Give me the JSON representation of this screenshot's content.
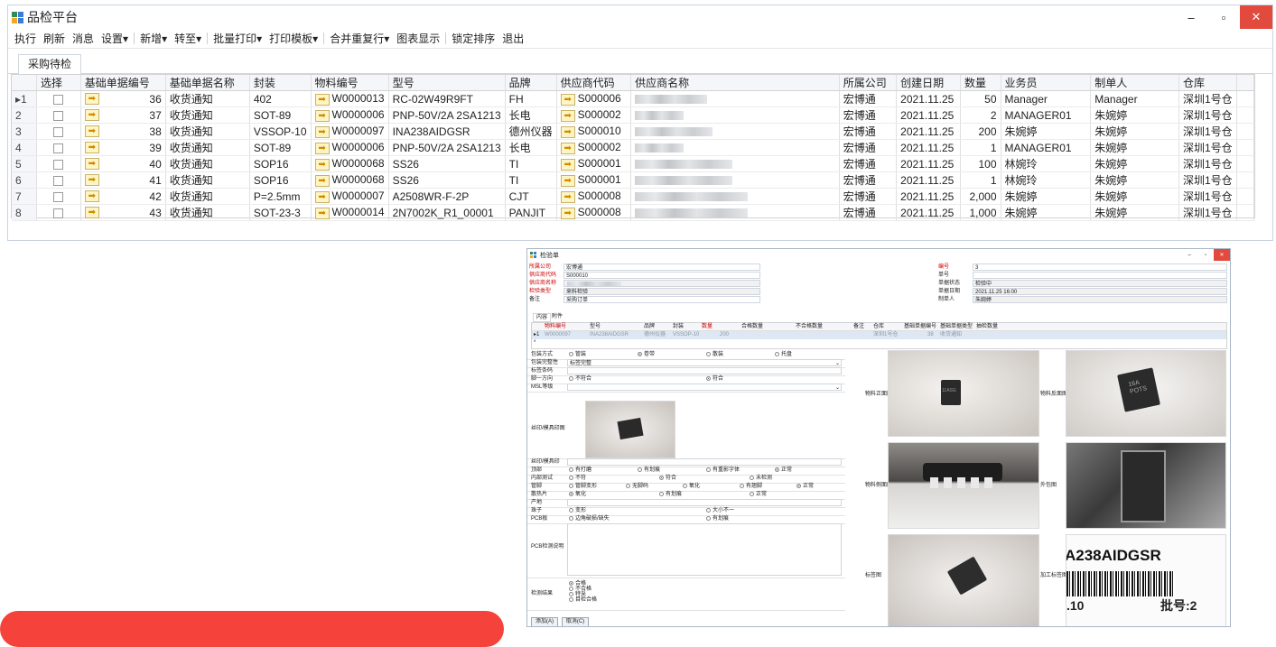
{
  "window": {
    "title": "品检平台",
    "minimize": "–",
    "maximize": "▫",
    "close": "✕"
  },
  "menu": [
    "执行",
    "刷新",
    "消息",
    "设置▾",
    "新增▾",
    "转至▾",
    "批量打印▾",
    "打印模板▾",
    "合并重复行▾",
    "图表显示",
    "锁定排序",
    "退出"
  ],
  "tab": "采购待检",
  "table": {
    "headers": [
      "",
      "选择",
      "基础单据编号",
      "基础单据名称",
      "封装",
      "物料编号",
      "型号",
      "品牌",
      "供应商代码",
      "供应商名称",
      "所属公司",
      "创建日期",
      "数量",
      "业务员",
      "制单人",
      "仓库"
    ],
    "rows": [
      {
        "idx": "▸1",
        "no": "36",
        "name": "收货通知",
        "pkg": "402",
        "mat": "W0000013",
        "model": "RC-02W49R9FT",
        "brand": "FH",
        "sup": "S000006",
        "co": "宏博通",
        "date": "2021.11.25",
        "qty": "50",
        "sales": "Manager",
        "maker": "Manager",
        "wh": "深圳1号仓"
      },
      {
        "idx": "2",
        "no": "37",
        "name": "收货通知",
        "pkg": "SOT-89",
        "mat": "W0000006",
        "model": "PNP-50V/2A 2SA1213",
        "brand": "长电",
        "sup": "S000002",
        "co": "宏博通",
        "date": "2021.11.25",
        "qty": "2",
        "sales": "MANAGER01",
        "maker": "朱婉婷",
        "wh": "深圳1号仓"
      },
      {
        "idx": "3",
        "no": "38",
        "name": "收货通知",
        "pkg": "VSSOP-10",
        "mat": "W0000097",
        "model": "INA238AIDGSR",
        "brand": "德州仪器",
        "sup": "S000010",
        "co": "宏博通",
        "date": "2021.11.25",
        "qty": "200",
        "sales": "朱婉婷",
        "maker": "朱婉婷",
        "wh": "深圳1号仓"
      },
      {
        "idx": "4",
        "no": "39",
        "name": "收货通知",
        "pkg": "SOT-89",
        "mat": "W0000006",
        "model": "PNP-50V/2A 2SA1213",
        "brand": "长电",
        "sup": "S000002",
        "co": "宏博通",
        "date": "2021.11.25",
        "qty": "1",
        "sales": "MANAGER01",
        "maker": "朱婉婷",
        "wh": "深圳1号仓"
      },
      {
        "idx": "5",
        "no": "40",
        "name": "收货通知",
        "pkg": "SOP16",
        "mat": "W0000068",
        "model": "SS26",
        "brand": "TI",
        "sup": "S000001",
        "co": "宏博通",
        "date": "2021.11.25",
        "qty": "100",
        "sales": "林婉玲",
        "maker": "朱婉婷",
        "wh": "深圳1号仓"
      },
      {
        "idx": "6",
        "no": "41",
        "name": "收货通知",
        "pkg": "SOP16",
        "mat": "W0000068",
        "model": "SS26",
        "brand": "TI",
        "sup": "S000001",
        "co": "宏博通",
        "date": "2021.11.25",
        "qty": "1",
        "sales": "林婉玲",
        "maker": "朱婉婷",
        "wh": "深圳1号仓"
      },
      {
        "idx": "7",
        "no": "42",
        "name": "收货通知",
        "pkg": "P=2.5mm",
        "mat": "W0000007",
        "model": "A2508WR-F-2P",
        "brand": "CJT",
        "sup": "S000008",
        "co": "宏博通",
        "date": "2021.11.25",
        "qty": "2,000",
        "sales": "朱婉婷",
        "maker": "朱婉婷",
        "wh": "深圳1号仓"
      },
      {
        "idx": "8",
        "no": "43",
        "name": "收货通知",
        "pkg": "SOT-23-3",
        "mat": "W0000014",
        "model": "2N7002K_R1_00001",
        "brand": "PANJIT",
        "sup": "S000008",
        "co": "宏博通",
        "date": "2021.11.25",
        "qty": "1,000",
        "sales": "朱婉婷",
        "maker": "朱婉婷",
        "wh": "深圳1号仓"
      }
    ]
  },
  "dialog": {
    "title": "检验单",
    "labels": {
      "company": "所属公司",
      "supcode": "供应商代码",
      "supname": "供应商名称",
      "type": "检验类型",
      "remark": "备注",
      "billno": "编号",
      "billno2": "单号",
      "status": "单据状态",
      "billdate": "单据日期",
      "maker": "制单人"
    },
    "values": {
      "company": "宏博通",
      "supcode": "S000010",
      "type": "来料检验",
      "remark": "采购订单",
      "billno": "3",
      "status": "检验中",
      "billdate": "2021.11.25 16:00",
      "maker": "朱婉婷"
    },
    "tabs": [
      "内容",
      "附件"
    ],
    "grid_headers": [
      "物料编号",
      "型号",
      "品牌",
      "封装",
      "数量",
      "合格数量",
      "不合格数量",
      "备注",
      "仓库",
      "基础单据编号",
      "基础单据类型",
      "抽检数量"
    ],
    "grid_row": {
      "idx": "▸1",
      "mat": "W0000097",
      "model": "INA238AIDGSR",
      "brand": "德州仪器",
      "pkg": "VSSOP-10",
      "qty": "200",
      "wh": "深圳1号仓",
      "no": "38",
      "type": "收货通知"
    },
    "grid_row2": "*",
    "form": {
      "pack": {
        "label": "包装方式",
        "opts": [
          "管装",
          "卷带",
          "散装",
          "托盘"
        ],
        "sel": 1
      },
      "packok": {
        "label": "包装完整性",
        "value": "标签完整"
      },
      "tagcode": {
        "label": "标签条码"
      },
      "pin": {
        "label": "脚一方向",
        "opts": [
          "不符合",
          "符合"
        ],
        "sel": 1
      },
      "msl": {
        "label": "MSL等级"
      },
      "silk": {
        "label": "丝印/模具印图"
      },
      "silk2": {
        "label": "丝印/模具印"
      },
      "top": {
        "label": "顶部",
        "opts": [
          "有打磨",
          "有划痕",
          "有重影字体",
          "正常"
        ],
        "sel": 3
      },
      "inner": {
        "label": "内部测试",
        "opts": [
          "不符",
          "符合",
          "未检测"
        ],
        "sel": 1
      },
      "pins": {
        "label": "管脚",
        "opts": [
          "管脚变形",
          "无脚码",
          "氧化",
          "有翘脚",
          "正常"
        ],
        "sel": 4
      },
      "heat": {
        "label": "散热片",
        "opts": [
          "氧化",
          "有划痕",
          "正常"
        ],
        "sel": 0
      },
      "origin": {
        "label": "产地"
      },
      "ball": {
        "label": "珠子",
        "opts": [
          "变形",
          "大小不一"
        ],
        "sel": -1
      },
      "pcb": {
        "label": "PCB板",
        "opts": [
          "边角破损/缺失",
          "有划痕"
        ],
        "sel": -1
      },
      "pcbnote": {
        "label": "PCB检测说明"
      },
      "result": {
        "label": "检测结果",
        "opts": [
          "合格",
          "不合格",
          "特采",
          "目检合格"
        ],
        "sel": 0
      }
    },
    "photo_labels": {
      "front": "物料正面图",
      "back": "物料反面图",
      "side": "物料侧面图",
      "outer": "外包图",
      "tag": "标签图",
      "proc": "加工标签图"
    },
    "label_photo_text": {
      "line1": "A238AIDGSR",
      "line2": ".10",
      "line3": "批号:2"
    },
    "chip_text": {
      "front": "11ASG",
      "back": "16A\nPOTS"
    },
    "buttons": {
      "add": "添加(A)",
      "cancel": "取消(C)"
    }
  }
}
